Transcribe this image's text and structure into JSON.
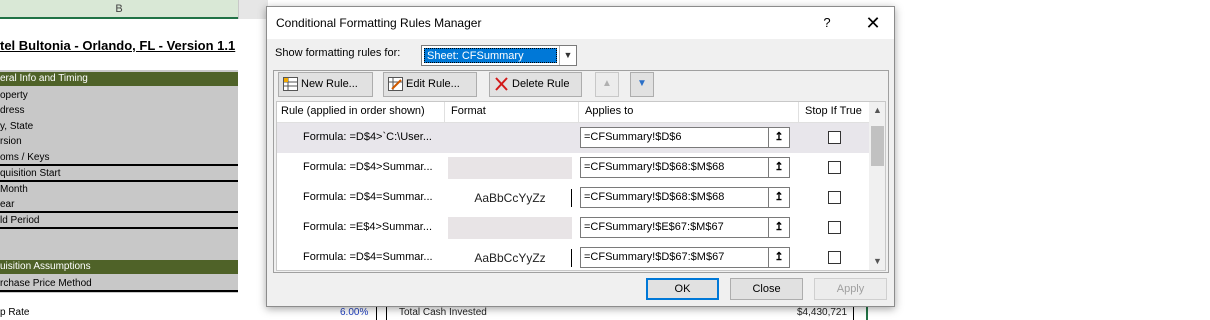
{
  "sheet": {
    "column_header": "B",
    "title": "tel Bultonia - Orlando, FL - Version 1.1",
    "section1": "eral Info and Timing",
    "rows1": [
      "operty",
      "dress",
      "y, State",
      "rsion",
      "oms / Keys",
      "quisition Start",
      "Month",
      "ear",
      "ld Period"
    ],
    "section2": "uisition Assumptions",
    "rows2": [
      "rchase Price Method"
    ],
    "bottom_label": "p Rate",
    "bottom_pct": "6.00%",
    "bottom_total_label": "Total Cash Invested",
    "bottom_total_value": "$4,430,721"
  },
  "dialog": {
    "title": "Conditional Formatting Rules Manager",
    "help": "?",
    "close": "✕",
    "show_label": "Show formatting rules for:",
    "show_value": "Sheet: CFSummary",
    "toolbar": {
      "new_rule": "New Rule...",
      "edit_rule": "Edit Rule...",
      "delete_rule": "Delete Rule",
      "move_up": "▲",
      "move_down": "▼"
    },
    "columns": {
      "rule": "Rule (applied in order shown)",
      "format": "Format",
      "applies": "Applies to",
      "stop": "Stop If True"
    },
    "rules": [
      {
        "rule": "Formula: =D$4>`C:\\User...",
        "format": "",
        "applies": "=CFSummary!$D$6",
        "stop": false
      },
      {
        "rule": "Formula: =D$4>Summar...",
        "format": "",
        "applies": "=CFSummary!$D$68:$M$68",
        "stop": false
      },
      {
        "rule": "Formula: =D$4=Summar...",
        "format": "AaBbCcYyZz",
        "applies": "=CFSummary!$D$68:$M$68",
        "stop": false
      },
      {
        "rule": "Formula: =E$4>Summar...",
        "format": "",
        "applies": "=CFSummary!$E$67:$M$67",
        "stop": false
      },
      {
        "rule": "Formula: =D$4=Summar...",
        "format": "AaBbCcYyZz",
        "applies": "=CFSummary!$D$67:$M$67",
        "stop": false
      }
    ],
    "ref_icon": "↥",
    "buttons": {
      "ok": "OK",
      "close": "Close",
      "apply": "Apply"
    }
  }
}
